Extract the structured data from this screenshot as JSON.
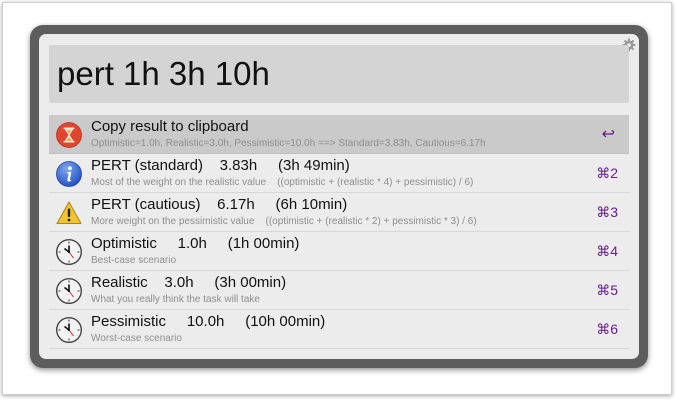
{
  "search": {
    "value": "pert 1h 3h 10h"
  },
  "results": [
    {
      "title": "Copy result to clipboard",
      "subtitle": "Optimistic=1.0h, Realistic=3.0h, Pessimistic=10.0h ==> Standard=3.83h, Cautious=6.17h",
      "shortcut": "↩",
      "icon": "hourglass-icon"
    },
    {
      "title": "PERT (standard)    3.83h     (3h 49min)",
      "subtitle": "Most of the weight on the realistic value    ((optimistic + (realistic * 4) + pessimistic) / 6)",
      "shortcut": "⌘2",
      "icon": "info-icon"
    },
    {
      "title": "PERT (cautious)    6.17h     (6h 10min)",
      "subtitle": "More weight on the pessimistic value    ((optimistic + (realistic * 2) + pessimistic * 3) / 6)",
      "shortcut": "⌘3",
      "icon": "warning-icon"
    },
    {
      "title": "Optimistic     1.0h     (1h 00min)",
      "subtitle": "Best-case scenario",
      "shortcut": "⌘4",
      "icon": "clock-icon"
    },
    {
      "title": "Realistic    3.0h     (3h 00min)",
      "subtitle": "What you really think the task will take",
      "shortcut": "⌘5",
      "icon": "clock-icon"
    },
    {
      "title": "Pessimistic     10.0h     (10h 00min)",
      "subtitle": "Worst-case scenario",
      "shortcut": "⌘6",
      "icon": "clock-icon"
    }
  ],
  "colors": {
    "shortcut": "#6a1b8e",
    "selected_row": "#cacaca",
    "window_border": "#5d5d5d"
  }
}
